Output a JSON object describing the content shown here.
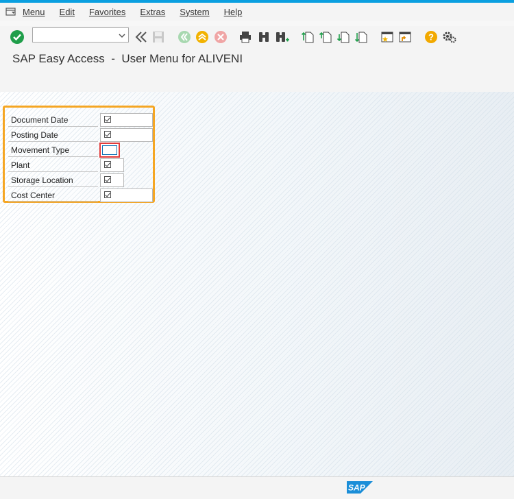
{
  "menubar": {
    "items": [
      {
        "label": "Menu"
      },
      {
        "label": "Edit"
      },
      {
        "label": "Favorites"
      },
      {
        "label": "Extras"
      },
      {
        "label": "System"
      },
      {
        "label": "Help"
      }
    ]
  },
  "toolbar": {
    "command_field_value": "",
    "icons": [
      "enter-icon",
      "back-icon",
      "save-icon",
      "back-green-icon",
      "exit-icon",
      "cancel-icon",
      "print-icon",
      "find-icon",
      "find-next-icon",
      "first-page-icon",
      "previous-page-icon",
      "next-page-icon",
      "last-page-icon",
      "new-session-icon",
      "shortcut-icon",
      "help-icon",
      "settings-icon"
    ]
  },
  "title": "SAP Easy Access  -  User Menu for ALIVENI",
  "fields": [
    {
      "label": "Document Date",
      "checked": true
    },
    {
      "label": "Posting Date",
      "checked": true
    },
    {
      "label": "Movement Type",
      "checked": false
    },
    {
      "label": "Plant",
      "checked": true
    },
    {
      "label": "Storage Location",
      "checked": true
    },
    {
      "label": "Cost Center",
      "checked": true
    }
  ],
  "colors": {
    "highlight": "#f5a623",
    "accent": "#0a9fe0",
    "sap_blue": "#1b8ed8",
    "enter_green": "#1f9e4a"
  },
  "footer": {
    "logo_text": "SAP"
  }
}
